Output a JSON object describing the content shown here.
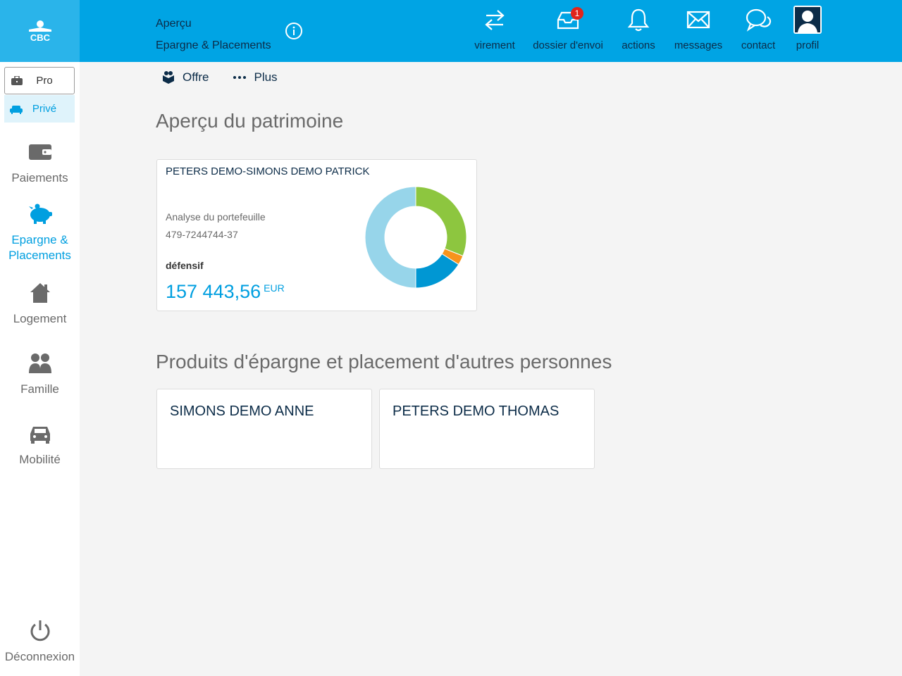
{
  "header": {
    "logo_text": "CBC",
    "breadcrumb": [
      "Aperçu",
      "Epargne & Placements"
    ],
    "nav": [
      {
        "label": "virement",
        "icon": "transfer-icon"
      },
      {
        "label": "dossier d'envoi",
        "icon": "outbox-icon",
        "badge": "1"
      },
      {
        "label": "actions",
        "icon": "bell-icon"
      },
      {
        "label": "messages",
        "icon": "envelope-icon"
      },
      {
        "label": "contact",
        "icon": "chat-icon"
      },
      {
        "label": "profil",
        "icon": "user-icon"
      }
    ]
  },
  "sidebar": {
    "segments": {
      "pro": "Pro",
      "prive": "Privé"
    },
    "items": [
      {
        "label": "Paiements",
        "icon": "wallet-icon"
      },
      {
        "label": "Epargne & Placements",
        "icon": "piggy-bank-icon"
      },
      {
        "label": "Logement",
        "icon": "house-icon"
      },
      {
        "label": "Famille",
        "icon": "family-icon"
      },
      {
        "label": "Mobilité",
        "icon": "car-icon"
      }
    ],
    "logout": "Déconnexion"
  },
  "subnav": {
    "offre": "Offre",
    "plus": "Plus"
  },
  "main": {
    "title": "Aperçu du patrimoine",
    "portfolio": {
      "holder": "PETERS DEMO-SIMONS DEMO PATRICK",
      "type": "Analyse du portefeuille",
      "account": "479-7244744-37",
      "profile": "défensif",
      "amount": "157 443,56",
      "currency": "EUR"
    },
    "others_title": "Produits d'épargne et placement d'autres personnes",
    "others": [
      "SIMONS DEMO ANNE",
      "PETERS DEMO THOMAS"
    ]
  },
  "colors": {
    "brand": "#00a4e4",
    "dark_text": "#0c2c48",
    "donut": [
      "#8dc63f",
      "#f7941d",
      "#0097d3",
      "#97d5ea"
    ]
  },
  "chart_data": {
    "type": "pie",
    "values": [
      31,
      3,
      16,
      50
    ]
  }
}
